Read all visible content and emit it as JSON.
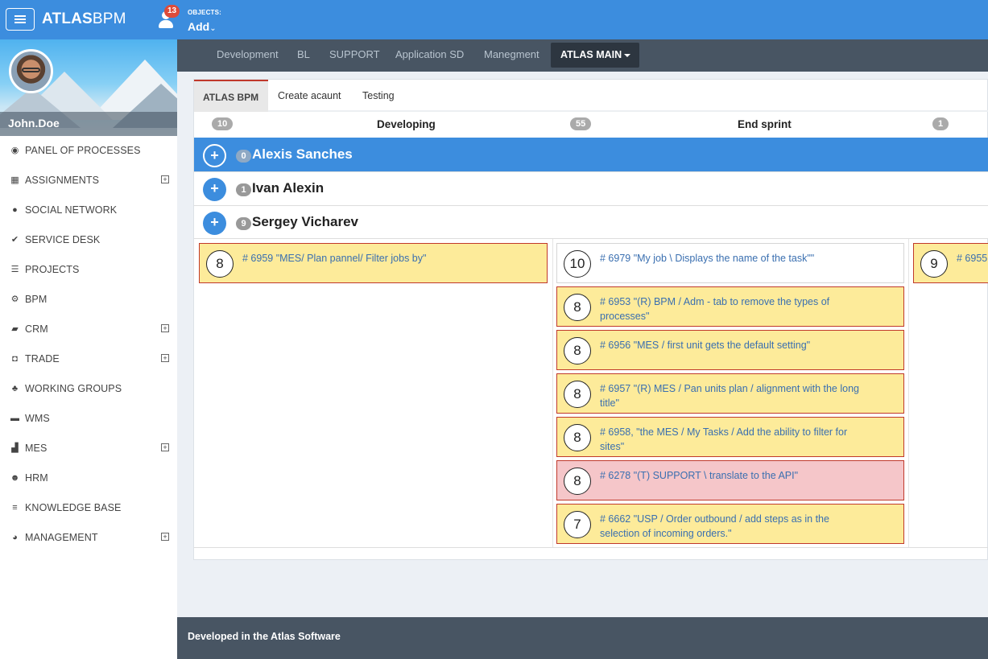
{
  "header": {
    "logo_bold": "ATLAS",
    "logo_light": "BPM",
    "notifications_count": "13",
    "objects_label": "OBJECTS:",
    "add_label": "Add",
    "add_chevron": "⌄"
  },
  "sidebar": {
    "user_name": "John.Doe",
    "items": [
      {
        "label": "PANEL OF PROCESSES",
        "icon": "dashboard-icon",
        "glyph": "◉",
        "expandable": false
      },
      {
        "label": "ASSIGNMENTS",
        "icon": "calendar-icon",
        "glyph": "▦",
        "expandable": true
      },
      {
        "label": "SOCIAL NETWORK",
        "icon": "comments-icon",
        "glyph": "●",
        "expandable": false
      },
      {
        "label": "SERVICE DESK",
        "icon": "check-icon",
        "glyph": "✔",
        "expandable": false
      },
      {
        "label": "PROJECTS",
        "icon": "list-icon",
        "glyph": "☰",
        "expandable": false
      },
      {
        "label": "BPM",
        "icon": "gears-icon",
        "glyph": "⚙",
        "expandable": false
      },
      {
        "label": "CRM",
        "icon": "book-icon",
        "glyph": "▰",
        "expandable": true
      },
      {
        "label": "TRADE",
        "icon": "money-icon",
        "glyph": "◘",
        "expandable": true
      },
      {
        "label": "WORKING GROUPS",
        "icon": "sitemap-icon",
        "glyph": "♣",
        "expandable": false
      },
      {
        "label": "WMS",
        "icon": "folder-open-icon",
        "glyph": "▬",
        "expandable": false
      },
      {
        "label": "MES",
        "icon": "industry-icon",
        "glyph": "▟",
        "expandable": true
      },
      {
        "label": "HRM",
        "icon": "users-icon",
        "glyph": "☻",
        "expandable": false
      },
      {
        "label": "KNOWLEDGE BASE",
        "icon": "database-icon",
        "glyph": "≡",
        "expandable": false
      },
      {
        "label": "MANAGEMENT",
        "icon": "pie-chart-icon",
        "glyph": "◕",
        "expandable": true
      }
    ],
    "expand_glyph": "+"
  },
  "subnav": {
    "tabs": [
      "Development",
      "BL",
      "SUPPORT",
      "Application SD",
      "Manegment"
    ],
    "active": "ATLAS MAIN"
  },
  "content": {
    "tabs": [
      "ATLAS BPM",
      "Create acaunt",
      "Testing"
    ],
    "stages": [
      {
        "count": "10",
        "name": "Developing"
      },
      {
        "count": "55",
        "name": "End sprint"
      },
      {
        "count": "1",
        "name": ""
      }
    ],
    "lanes": [
      {
        "count": "0",
        "name": "Alexis Sanches"
      },
      {
        "count": "1",
        "name": "Ivan Alexin"
      },
      {
        "count": "9",
        "name": "Sergey Vicharev"
      }
    ],
    "plus_glyph": "+",
    "tasks_col1": [
      {
        "points": "8",
        "text": "# 6959 \"MES/ Plan pannel/ Filter jobs by\"",
        "style": "yellow"
      }
    ],
    "tasks_col2": [
      {
        "points": "10",
        "text": "# 6979 \"My job \\ Displays the name of the task\"\"",
        "style": "white"
      },
      {
        "points": "8",
        "text": "# 6953 \"(R) BPM / Adm - tab to remove the types of processes\"",
        "style": "yellow"
      },
      {
        "points": "8",
        "text": "# 6956 \"MES / first unit gets the default setting\"",
        "style": "yellow"
      },
      {
        "points": "8",
        "text": "# 6957 \"(R) MES / Pan units plan / alignment with the long title\"",
        "style": "yellow"
      },
      {
        "points": "8",
        "text": "# 6958, \"the MES / My Tasks / Add the ability to filter for sites\"",
        "style": "yellow"
      },
      {
        "points": "8",
        "text": "# 6278 \"(T) SUPPORT \\ translate to the API\"",
        "style": "pink"
      },
      {
        "points": "7",
        "text": "# 6662 \"USP / Order outbound / add steps as in the selection of incoming orders.\"",
        "style": "yellow"
      }
    ],
    "tasks_col3": [
      {
        "points": "9",
        "text": "# 6955",
        "style": "yellow"
      }
    ]
  },
  "footer": {
    "text": "Developed in the Atlas Software"
  },
  "colors": {
    "header": "#3c8dde",
    "nav_dark": "#485563",
    "task_yellow": "#fdeb9a",
    "task_pink": "#f5c6c9",
    "task_border": "#c0392b",
    "badge_red": "#dd4b39"
  }
}
